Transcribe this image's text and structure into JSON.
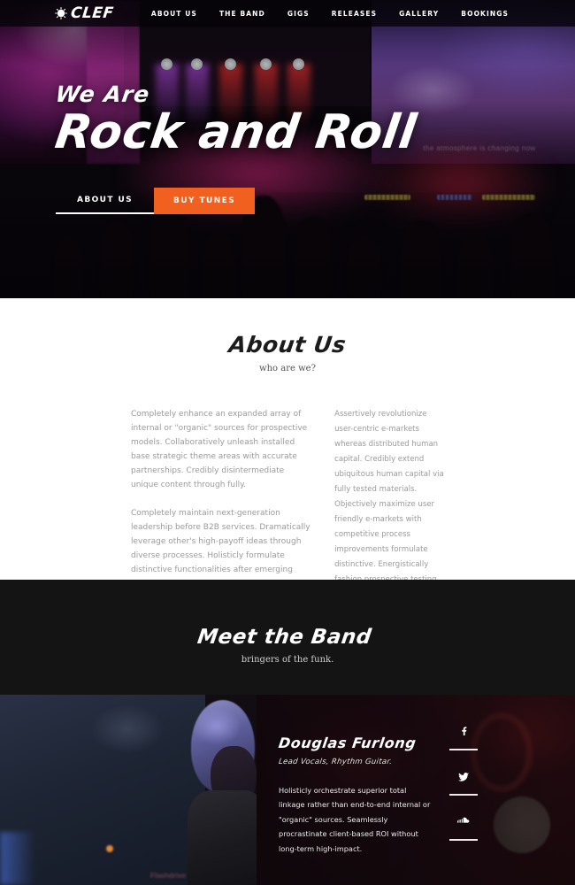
{
  "brand": {
    "name": "CLEF",
    "logo_icon": "sunburst-circle-icon"
  },
  "nav": {
    "items": [
      {
        "label": "ABOUT US"
      },
      {
        "label": "THE BAND"
      },
      {
        "label": "GIGS"
      },
      {
        "label": "RELEASES"
      },
      {
        "label": "GALLERY"
      },
      {
        "label": "BOOKINGS"
      }
    ]
  },
  "hero": {
    "eyebrow": "We Are",
    "title": "Rock and Roll",
    "background_screen_text": "the atmosphere is changing now",
    "buttons": {
      "secondary": "ABOUT US",
      "primary": "BUY TUNES"
    },
    "accent_color": "#f1601f"
  },
  "about": {
    "heading": "About Us",
    "subheading": "who are we?",
    "left_paragraphs": [
      "Completely enhance an expanded array of internal or \"organic\" sources for prospective models. Collaboratively unleash installed base strategic theme areas with accurate partnerships. Credibly disintermediate unique content through fully.",
      "Completely maintain next-generation leadership before B2B services. Dramatically leverage other's high-payoff ideas through diverse processes. Holisticly formulate distinctive functionalities after emerging niche markets. Interactively communicate interactive relationships without equity invested content. Enthusiastically monetize high-payoff ROI"
    ],
    "right_paragraph": "Assertively revolutionize user-centric e-markets whereas distributed human capital. Credibly extend ubiquitous human capital via fully tested materials. Objectively maximize user friendly e-markets with competitive process improvements formulate distinctive. Energistically fashion prospective testing procedures through quality methods of empowerment. Monotonectally"
  },
  "band": {
    "heading": "Meet the Band",
    "subheading": "bringers of the funk.",
    "member": {
      "name": "Douglas Furlong",
      "role": "Lead Vocals, Rhythm Guitar.",
      "bio": "Holisticly orchestrate superior total linkage rather than end-to-end internal or \"organic\" sources. Seamlessly procrastinate client-based ROI without long-term high-impact.",
      "social": [
        {
          "name": "facebook-icon",
          "label": "Facebook"
        },
        {
          "name": "twitter-icon",
          "label": "Twitter"
        },
        {
          "name": "soundcloud-icon",
          "label": "SoundCloud"
        }
      ]
    }
  }
}
